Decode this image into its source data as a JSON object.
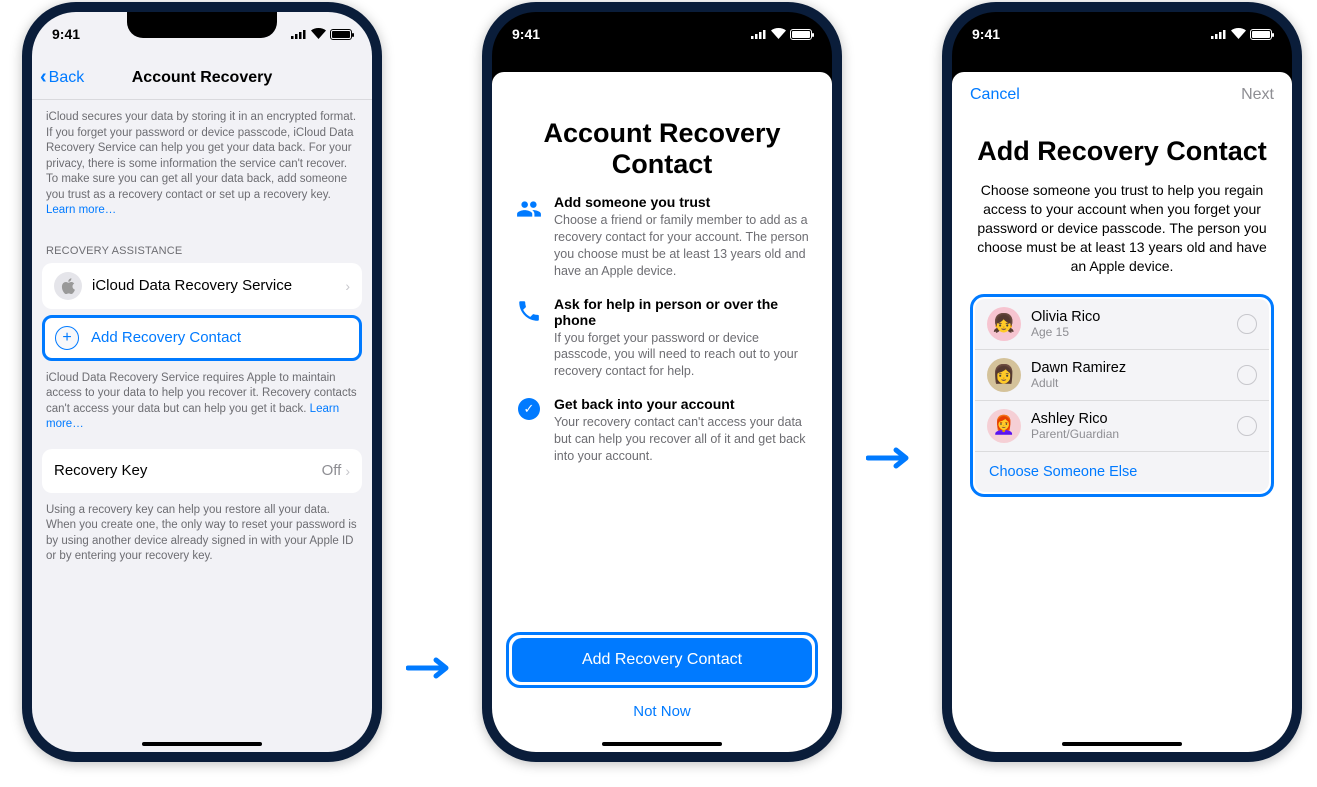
{
  "status": {
    "time": "9:41"
  },
  "phone1": {
    "back": "Back",
    "title": "Account Recovery",
    "intro": "iCloud secures your data by storing it in an encrypted format. If you forget your password or device passcode, iCloud Data Recovery Service can help you get your data back. For your privacy, there is some information the service can't recover. To make sure you can get all your data back, add someone you trust as a recovery contact or set up a recovery key. ",
    "learn_more": "Learn more…",
    "section": "RECOVERY ASSISTANCE",
    "row_icloud": "iCloud Data Recovery Service",
    "row_add": "Add Recovery Contact",
    "footer1": "iCloud Data Recovery Service requires Apple to maintain access to your data to help you recover it. Recovery contacts can't access your data but can help you get it back. ",
    "row_key": "Recovery Key",
    "row_key_value": "Off",
    "footer2": "Using a recovery key can help you restore all your data. When you create one, the only way to reset your password is by using another device already signed in with your Apple ID or by entering your recovery key."
  },
  "phone2": {
    "title": "Account Recovery Contact",
    "items": [
      {
        "title": "Add someone you trust",
        "text": "Choose a friend or family member to add as a recovery contact for your account. The person you choose must be at least 13 years old and have an Apple device."
      },
      {
        "title": "Ask for help in person or over the phone",
        "text": "If you forget your password or device passcode, you will need to reach out to your recovery contact for help."
      },
      {
        "title": "Get back into your account",
        "text": "Your recovery contact can't access your data but can help you recover all of it and get back into your account."
      }
    ],
    "primary": "Add Recovery Contact",
    "secondary": "Not Now"
  },
  "phone3": {
    "cancel": "Cancel",
    "next": "Next",
    "title": "Add Recovery Contact",
    "desc": "Choose someone you trust to help you regain access to your account when you forget your password or device passcode. The person you choose must be at least 13 years old and have an Apple device.",
    "contacts": [
      {
        "name": "Olivia Rico",
        "sub": "Age 15"
      },
      {
        "name": "Dawn Ramirez",
        "sub": "Adult"
      },
      {
        "name": "Ashley Rico",
        "sub": "Parent/Guardian"
      }
    ],
    "else": "Choose Someone Else"
  }
}
